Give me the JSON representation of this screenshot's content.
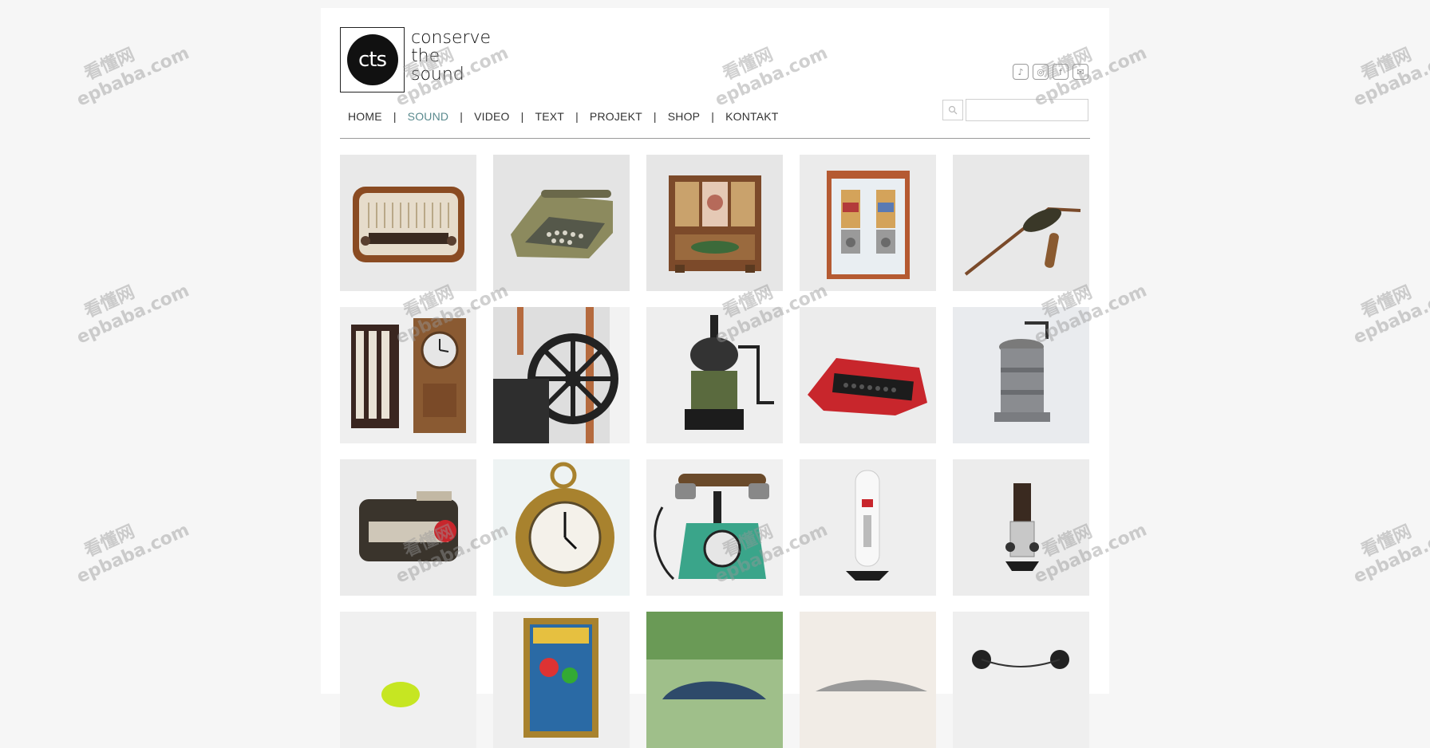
{
  "logo": {
    "mark": "cts",
    "lines": [
      "conserve",
      "the",
      "sound"
    ]
  },
  "social": [
    {
      "name": "tiktok-icon",
      "glyph": "♪"
    },
    {
      "name": "instagram-icon",
      "glyph": "◎"
    },
    {
      "name": "facebook-icon",
      "glyph": "f"
    },
    {
      "name": "mail-icon",
      "glyph": "✉"
    }
  ],
  "nav": {
    "items": [
      "HOME",
      "SOUND",
      "VIDEO",
      "TEXT",
      "PROJEKT",
      "SHOP",
      "KONTAKT"
    ],
    "active": "SOUND",
    "separator": "|"
  },
  "search": {
    "placeholder": "",
    "value": ""
  },
  "watermark": {
    "cn": "看懂网",
    "en": "epbaba.com"
  },
  "grid": {
    "items": [
      {
        "name": "radio"
      },
      {
        "name": "typewriter-olive"
      },
      {
        "name": "music-box"
      },
      {
        "name": "gumball-dispenser"
      },
      {
        "name": "crank-tool"
      },
      {
        "name": "time-clock"
      },
      {
        "name": "flywheel-machine"
      },
      {
        "name": "coffee-grinder-black"
      },
      {
        "name": "typewriter-red"
      },
      {
        "name": "coffee-grinder-metal"
      },
      {
        "name": "bakelite-device"
      },
      {
        "name": "alarm-clock"
      },
      {
        "name": "telephone-green"
      },
      {
        "name": "white-device"
      },
      {
        "name": "chrome-device"
      },
      {
        "name": "green-object"
      },
      {
        "name": "pinball-art"
      },
      {
        "name": "blue-car"
      },
      {
        "name": "silver-car"
      },
      {
        "name": "reel-machine"
      }
    ]
  }
}
